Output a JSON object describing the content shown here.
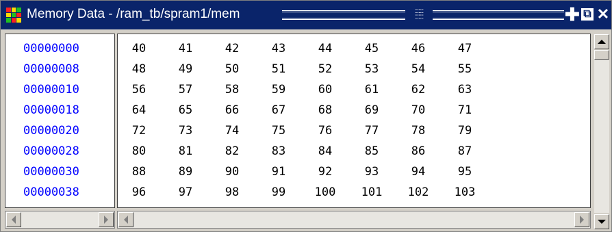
{
  "window": {
    "title": "Memory Data - /ram_tb/spram1/mem",
    "accent": "#0a246a",
    "address_color": "#0000ff",
    "buttons": {
      "plus": "✚",
      "undock": "⧉",
      "close": "✕"
    }
  },
  "memory": {
    "addresses": [
      "00000000",
      "00000008",
      "00000010",
      "00000018",
      "00000020",
      "00000028",
      "00000030",
      "00000038"
    ],
    "rows": [
      [
        "40",
        "41",
        "42",
        "43",
        "44",
        "45",
        "46",
        "47"
      ],
      [
        "48",
        "49",
        "50",
        "51",
        "52",
        "53",
        "54",
        "55"
      ],
      [
        "56",
        "57",
        "58",
        "59",
        "60",
        "61",
        "62",
        "63"
      ],
      [
        "64",
        "65",
        "66",
        "67",
        "68",
        "69",
        "70",
        "71"
      ],
      [
        "72",
        "73",
        "74",
        "75",
        "76",
        "77",
        "78",
        "79"
      ],
      [
        "80",
        "81",
        "82",
        "83",
        "84",
        "85",
        "86",
        "87"
      ],
      [
        "88",
        "89",
        "90",
        "91",
        "92",
        "93",
        "94",
        "95"
      ],
      [
        "96",
        "97",
        "98",
        "99",
        "100",
        "101",
        "102",
        "103"
      ]
    ]
  },
  "icons": {
    "app": "memory-window-icon",
    "scroll_up": "arrow-up-icon",
    "scroll_down": "arrow-down-icon",
    "scroll_left": "arrow-left-icon",
    "scroll_right": "arrow-right-icon"
  }
}
